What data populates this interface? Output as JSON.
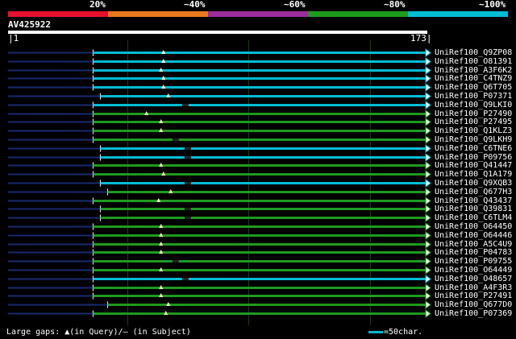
{
  "legend": {
    "colors": [
      "#e8112d",
      "#e87a1e",
      "#9b2c9c",
      "#1e9b1e",
      "#00bcd4"
    ],
    "labels": [
      "20%",
      "~40%",
      "~60%",
      "~80%",
      "~100%"
    ]
  },
  "query": {
    "id": "AV425922",
    "start": "1",
    "end": "173",
    "length": 173
  },
  "hits": [
    {
      "name": "UniRef100_Q9ZP08",
      "color": "#00bcd4",
      "start": 36,
      "gap": 65,
      "marker": "query"
    },
    {
      "name": "UniRef100_O81391",
      "color": "#00bcd4",
      "start": 36,
      "gap": 65,
      "marker": "query"
    },
    {
      "name": "UniRef100_A3F6K2",
      "color": "#00bcd4",
      "start": 36,
      "gap": 64,
      "marker": "query"
    },
    {
      "name": "UniRef100_C4TNZ9",
      "color": "#00bcd4",
      "start": 36,
      "gap": 65,
      "marker": "query"
    },
    {
      "name": "UniRef100_Q6T705",
      "color": "#00bcd4",
      "start": 36,
      "gap": 65,
      "marker": "query"
    },
    {
      "name": "UniRef100_P07371",
      "color": "#00bcd4",
      "start": 39,
      "gap": 67,
      "marker": "query"
    },
    {
      "name": "UniRef100_Q9LKI0",
      "color": "#00bcd4",
      "start": 36,
      "gap": 74,
      "marker": "subject"
    },
    {
      "name": "UniRef100_P27490",
      "color": "#1e9b1e",
      "start": 36,
      "gap": 58,
      "marker": "query"
    },
    {
      "name": "UniRef100_P27495",
      "color": "#1e9b1e",
      "start": 36,
      "gap": 64,
      "marker": "query"
    },
    {
      "name": "UniRef100_Q1KLZ3",
      "color": "#1e9b1e",
      "start": 36,
      "gap": 64,
      "marker": "query"
    },
    {
      "name": "UniRef100_Q9LKH9",
      "color": "#1e9b1e",
      "start": 36,
      "gap": 70,
      "marker": "subject"
    },
    {
      "name": "UniRef100_C6TNE6",
      "color": "#00bcd4",
      "start": 39,
      "gap": 75,
      "marker": "subject"
    },
    {
      "name": "UniRef100_P09756",
      "color": "#00bcd4",
      "start": 39,
      "gap": 75,
      "marker": "subject"
    },
    {
      "name": "UniRef100_Q41447",
      "color": "#1e9b1e",
      "start": 36,
      "gap": 64,
      "marker": "query"
    },
    {
      "name": "UniRef100_Q1A179",
      "color": "#1e9b1e",
      "start": 36,
      "gap": 65,
      "marker": "query"
    },
    {
      "name": "UniRef100_Q9XQB3",
      "color": "#00bcd4",
      "start": 39,
      "gap": 75,
      "marker": "subject"
    },
    {
      "name": "UniRef100_Q677H3",
      "color": "#1e9b1e",
      "start": 42,
      "gap": 68,
      "marker": "query"
    },
    {
      "name": "UniRef100_Q43437",
      "color": "#1e9b1e",
      "start": 36,
      "gap": 63,
      "marker": "query"
    },
    {
      "name": "UniRef100_Q39831",
      "color": "#1e9b1e",
      "start": 39,
      "gap": 75,
      "marker": "subject"
    },
    {
      "name": "UniRef100_C6TLM4",
      "color": "#1e9b1e",
      "start": 39,
      "gap": 75,
      "marker": "subject"
    },
    {
      "name": "UniRef100_O64450",
      "color": "#1e9b1e",
      "start": 36,
      "gap": 64,
      "marker": "query"
    },
    {
      "name": "UniRef100_O64446",
      "color": "#1e9b1e",
      "start": 36,
      "gap": 64,
      "marker": "query"
    },
    {
      "name": "UniRef100_A5C4U9",
      "color": "#1e9b1e",
      "start": 36,
      "gap": 64,
      "marker": "query"
    },
    {
      "name": "UniRef100_P04783",
      "color": "#1e9b1e",
      "start": 36,
      "gap": 64,
      "marker": "query"
    },
    {
      "name": "UniRef100_P09755",
      "color": "#1e9b1e",
      "start": 36,
      "gap": 70,
      "marker": "subject"
    },
    {
      "name": "UniRef100_O64449",
      "color": "#1e9b1e",
      "start": 36,
      "gap": 64,
      "marker": "query"
    },
    {
      "name": "UniRef100_O48657",
      "color": "#00bcd4",
      "start": 36,
      "gap": 74,
      "marker": "subject"
    },
    {
      "name": "UniRef100_A4F3R3",
      "color": "#1e9b1e",
      "start": 36,
      "gap": 64,
      "marker": "query"
    },
    {
      "name": "UniRef100_P27491",
      "color": "#1e9b1e",
      "start": 36,
      "gap": 64,
      "marker": "query"
    },
    {
      "name": "UniRef100_Q677D0",
      "color": "#1e9b1e",
      "start": 42,
      "gap": 67,
      "marker": "query"
    },
    {
      "name": "UniRef100_P07369",
      "color": "#1e9b1e",
      "start": 36,
      "gap": 66,
      "marker": "query"
    }
  ],
  "footer": {
    "text": "Large gaps: ▲(in Query)/– (in Subject)",
    "scale_label": "=50char."
  }
}
